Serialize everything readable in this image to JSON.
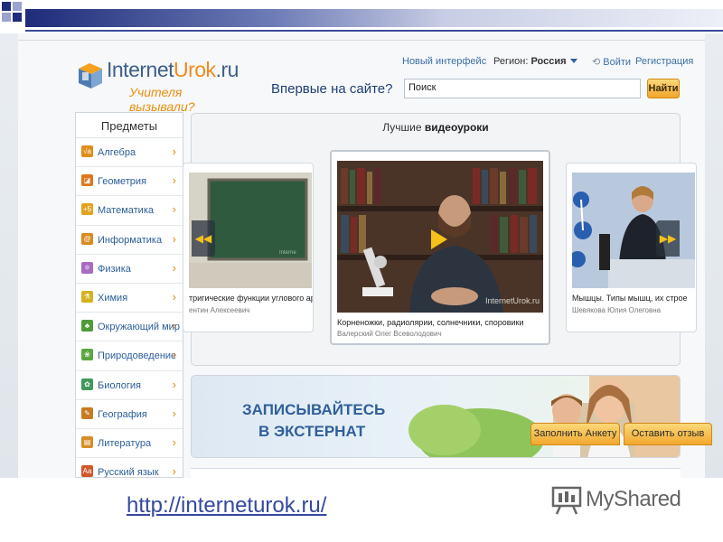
{
  "header": {
    "logo_title_a": "Internet",
    "logo_title_b": "Urok",
    "logo_title_c": ".ru",
    "logo_tagline": "Учителя вызывали?",
    "first_time": "Впервые на сайте?",
    "new_interface": "Новый интерфейс",
    "region_label": "Регион:",
    "region_value": "Россия",
    "login": "Войти",
    "register": "Регистрация",
    "search_value": "Поиск",
    "search_button": "Найти"
  },
  "sidebar": {
    "title": "Предметы",
    "items": [
      {
        "label": "Алгебра",
        "icon": "algebra-icon",
        "glyph": "√a",
        "color": "#e08d1a"
      },
      {
        "label": "Геометрия",
        "icon": "geometry-icon",
        "glyph": "◪",
        "color": "#e0761a"
      },
      {
        "label": "Математика",
        "icon": "math-icon",
        "glyph": "+5",
        "color": "#e3a21d"
      },
      {
        "label": "Информатика",
        "icon": "informatics-icon",
        "glyph": "@",
        "color": "#d98a20"
      },
      {
        "label": "Физика",
        "icon": "physics-icon",
        "glyph": "⚛",
        "color": "#a86cc4"
      },
      {
        "label": "Химия",
        "icon": "chemistry-icon",
        "glyph": "⚗",
        "color": "#d4b21f"
      },
      {
        "label": "Окружающий мир",
        "icon": "world-icon",
        "glyph": "♣",
        "color": "#4d9b3a"
      },
      {
        "label": "Природоведение",
        "icon": "nature-icon",
        "glyph": "❀",
        "color": "#5aa73f"
      },
      {
        "label": "Биология",
        "icon": "biology-icon",
        "glyph": "✿",
        "color": "#3f9a5a"
      },
      {
        "label": "География",
        "icon": "geography-icon",
        "glyph": "✎",
        "color": "#c77a22"
      },
      {
        "label": "Литература",
        "icon": "literature-icon",
        "glyph": "▤",
        "color": "#d88d28"
      },
      {
        "label": "Русский язык",
        "icon": "russian-icon",
        "glyph": "Аа",
        "color": "#d2572c"
      }
    ]
  },
  "videos": {
    "title_a": "Лучшие ",
    "title_b": "видеоуроки",
    "cards": [
      {
        "caption": "тригические функции углового ар",
        "author": "ентин Алексеевич"
      },
      {
        "caption": "Корненожки, радиолярии, солнечники, споровики",
        "author": "Валерский Олег Всеволодович",
        "watermark": "InternetUrok.ru"
      },
      {
        "caption": "Мышцы. Типы мышц, их строе",
        "author": "Шевякова Юлия Олеговна"
      }
    ]
  },
  "banner": {
    "line1": "ЗАПИСЫВАЙТЕСЬ",
    "line2": "В ЭКСТЕРНАТ"
  },
  "buttons": {
    "fill_form": "Заполнить Анкету",
    "leave_review": "Оставить отзыв"
  },
  "footer": {
    "url": "http://interneturok.ru/",
    "brand": "MyShared"
  }
}
